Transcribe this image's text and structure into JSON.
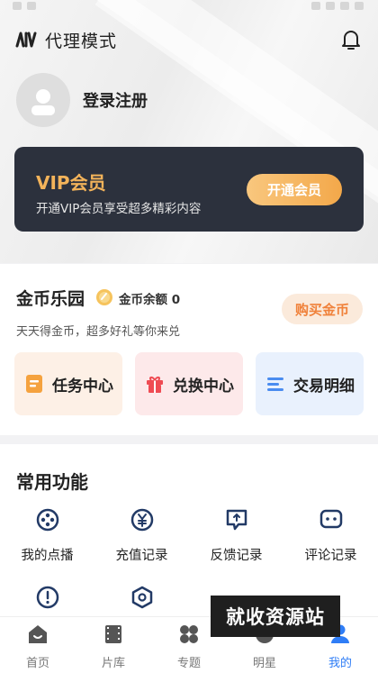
{
  "header": {
    "title": "代理模式",
    "logo_icon": "brand-logo-icon",
    "bell_icon": "bell-icon"
  },
  "profile": {
    "login_text": "登录注册",
    "avatar_icon": "user-avatar-icon"
  },
  "vip": {
    "title": "VIP会员",
    "subtitle": "开通VIP会员享受超多精彩内容",
    "button": "开通会员",
    "accent": "#f3b35a",
    "background": "#2c313d"
  },
  "coins": {
    "title": "金币乐园",
    "balance_text": "金币余额 0",
    "buy_button": "购买金币",
    "subtitle": "天天得金币，超多好礼等你来兑",
    "tiles": [
      {
        "label": "任务中心",
        "icon": "task-icon",
        "bg": "#fdf0e6",
        "color": "#f5a23e"
      },
      {
        "label": "兑换中心",
        "icon": "gift-icon",
        "bg": "#fde9ea",
        "color": "#ef4b53"
      },
      {
        "label": "交易明细",
        "icon": "list-icon",
        "bg": "#e9f1fd",
        "color": "#4a8cf0"
      }
    ]
  },
  "functions": {
    "title": "常用功能",
    "items": [
      {
        "label": "我的点播",
        "icon": "film-reel-icon"
      },
      {
        "label": "充值记录",
        "icon": "yen-icon"
      },
      {
        "label": "反馈记录",
        "icon": "feedback-icon"
      },
      {
        "label": "评论记录",
        "icon": "comment-icon"
      },
      {
        "label": "",
        "icon": "alert-icon"
      },
      {
        "label": "",
        "icon": "hexagon-icon"
      }
    ]
  },
  "tabbar": {
    "items": [
      {
        "label": "首页",
        "icon": "home-icon"
      },
      {
        "label": "片库",
        "icon": "film-icon"
      },
      {
        "label": "专题",
        "icon": "grid-icon"
      },
      {
        "label": "明星",
        "icon": "star-person-icon"
      },
      {
        "label": "我的",
        "icon": "user-icon",
        "active": true
      }
    ],
    "active_color": "#2f7df6"
  },
  "watermark": {
    "text": "就收资源站"
  }
}
